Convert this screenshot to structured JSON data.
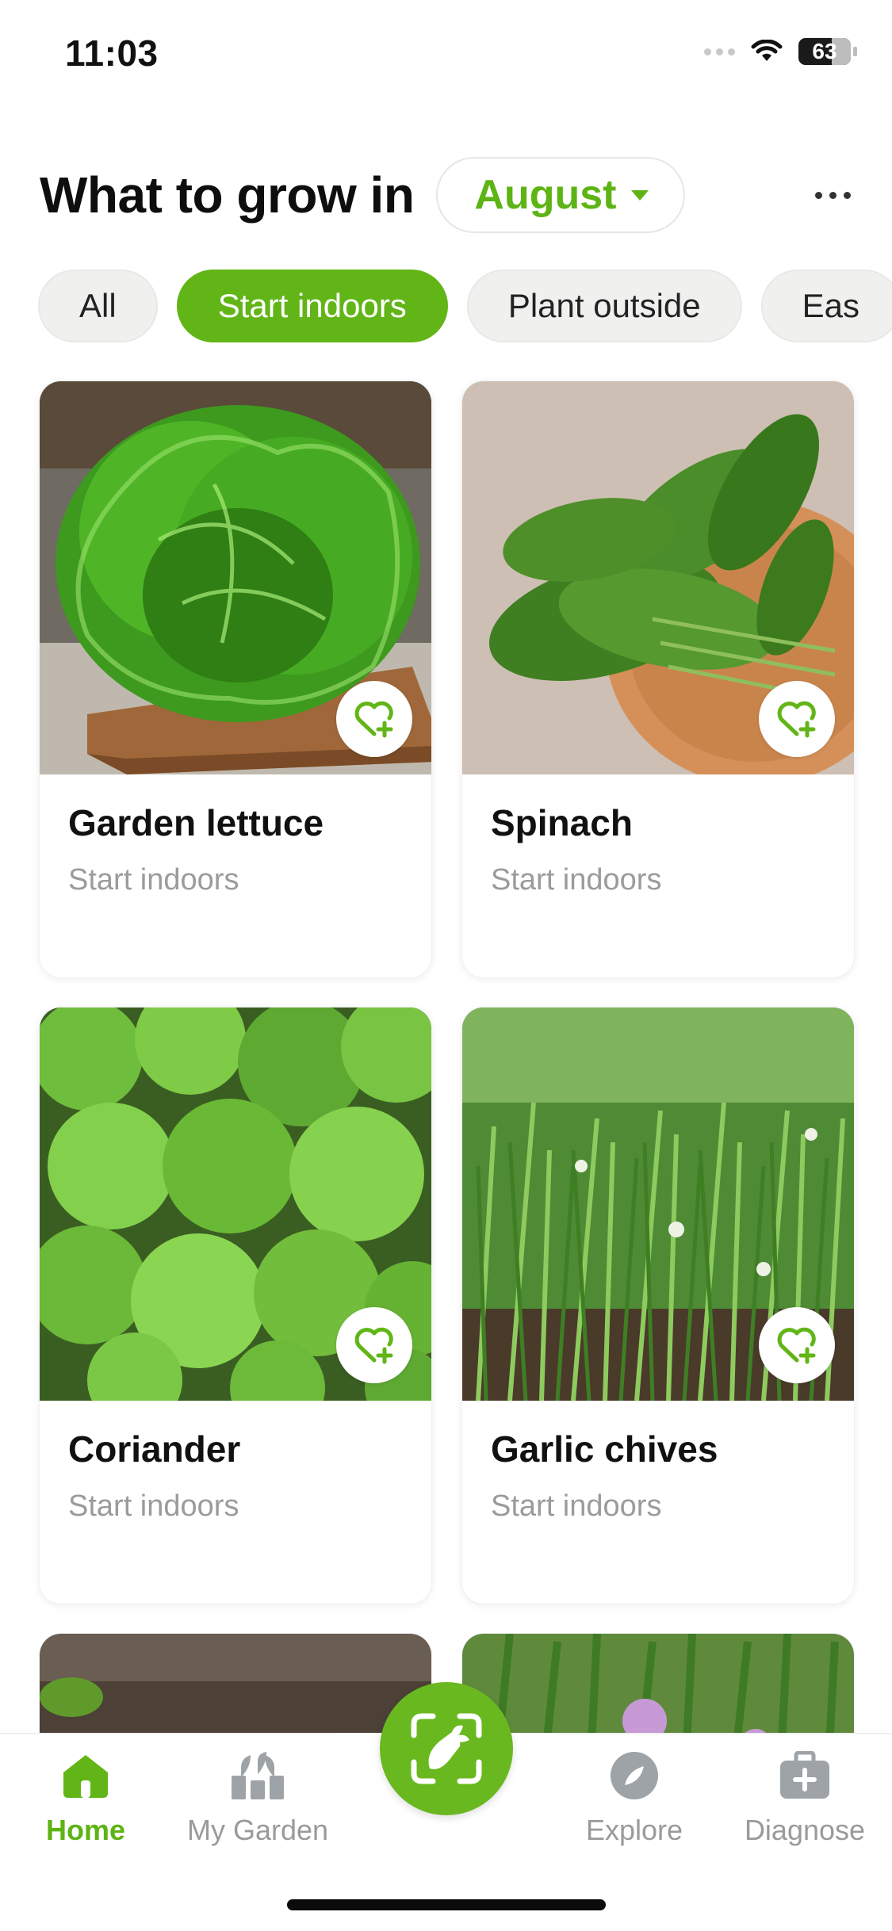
{
  "status_bar": {
    "time": "11:03",
    "battery": "63"
  },
  "header": {
    "title": "What to grow in",
    "month": "August"
  },
  "filters": [
    {
      "label": "All",
      "active": false
    },
    {
      "label": "Start indoors",
      "active": true
    },
    {
      "label": "Plant outside",
      "active": false
    },
    {
      "label": "Eas",
      "active": false
    }
  ],
  "plants": [
    {
      "name": "Garden lettuce",
      "status": "Start indoors",
      "image": "lettuce-photo"
    },
    {
      "name": "Spinach",
      "status": "Start indoors",
      "image": "spinach-photo"
    },
    {
      "name": "Coriander",
      "status": "Start indoors",
      "image": "coriander-photo"
    },
    {
      "name": "Garlic chives",
      "status": "Start indoors",
      "image": "chives-photo"
    }
  ],
  "tabs": [
    {
      "label": "Home",
      "icon": "home-icon",
      "active": true
    },
    {
      "label": "My Garden",
      "icon": "garden-icon",
      "active": false
    },
    {
      "label": "Explore",
      "icon": "compass-icon",
      "active": false
    },
    {
      "label": "Diagnose",
      "icon": "first-aid-kit-icon",
      "active": false
    }
  ],
  "colors": {
    "accent": "#62b517",
    "muted_text": "#9b9b9b",
    "chip_bg": "#f0f1ef"
  }
}
